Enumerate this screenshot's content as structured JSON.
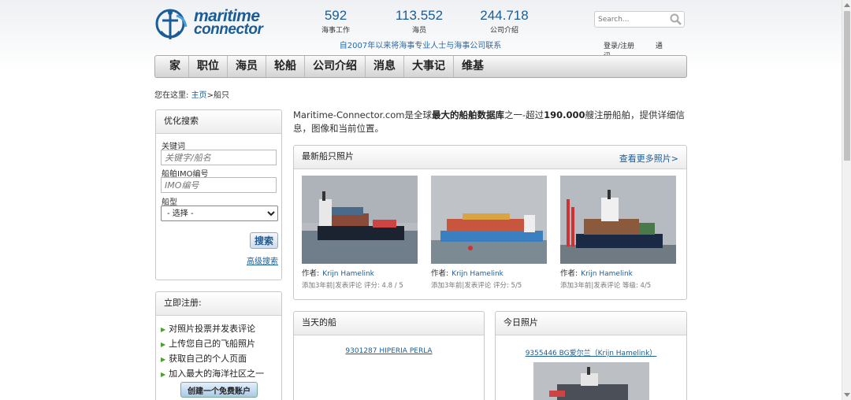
{
  "logo": {
    "line1": "maritime",
    "line2": "connector"
  },
  "stats": [
    {
      "number": "592",
      "label": "海事工作"
    },
    {
      "number": "113.552",
      "label": "海员"
    },
    {
      "number": "244.718",
      "label": "公司介绍"
    }
  ],
  "tagline": "自2007年以来将海事专业人士与海事公司联系",
  "search": {
    "placeholder": "Search..."
  },
  "toplinks": {
    "login": "登录/注册",
    "contact": "通讯"
  },
  "nav": [
    "家",
    "职位",
    "海员",
    "轮船",
    "公司介绍",
    "消息",
    "大事记",
    "维基"
  ],
  "breadcrumb": {
    "prefix": "您在这里:",
    "home": "主页",
    "sep": ">",
    "current": "船只"
  },
  "refine": {
    "title": "优化搜索",
    "keyword_label": "关键词",
    "keyword_placeholder": "关键字/船名",
    "imo_label": "船舶IMO编号",
    "imo_placeholder": "IMO编号",
    "type_label": "船型",
    "type_selected": "- 选择 -",
    "search_button": "搜索",
    "advanced": "高级搜索"
  },
  "register": {
    "title": "立即注册:",
    "items": [
      "对照片投票并发表评论",
      "上传您自己的飞船照片",
      "获取自己的个人页面",
      "加入最大的海洋社区之一"
    ],
    "button": "创建一个免费账户"
  },
  "intro": {
    "part1": "Maritime-Connector.com是全球",
    "bold1": "最大的船舶数据库",
    "part2": "之一-超过",
    "bold2": "190.000",
    "part3": "艘注册船舶，提供详细信息，图像和当前位置。"
  },
  "latest": {
    "title": "最新船只照片",
    "see_more": "查看更多照片>",
    "photos": [
      {
        "author_label": "作者:",
        "author": "Krijn Hamelink",
        "meta": "添加3年前|发表评论 评分: 4.8 / 5"
      },
      {
        "author_label": "作者:",
        "author": "Krijn Hamelink",
        "meta": "添加3年前|发表评论 评分: 5/5"
      },
      {
        "author_label": "作者:",
        "author": "Krijn Hamelink",
        "meta": "添加3年前|发表评论 等级: 4/5"
      }
    ]
  },
  "ship_of_day": {
    "title": "当天的船",
    "link": "9301287 HIPERIA PERLA"
  },
  "photo_of_day": {
    "title": "今日照片",
    "link": "9355446 BG爱尔兰（Krijn Hamelink）"
  },
  "colors": {
    "brand": "#1b5c97",
    "link": "#1a5d99",
    "arrow": "#4aa02c"
  }
}
